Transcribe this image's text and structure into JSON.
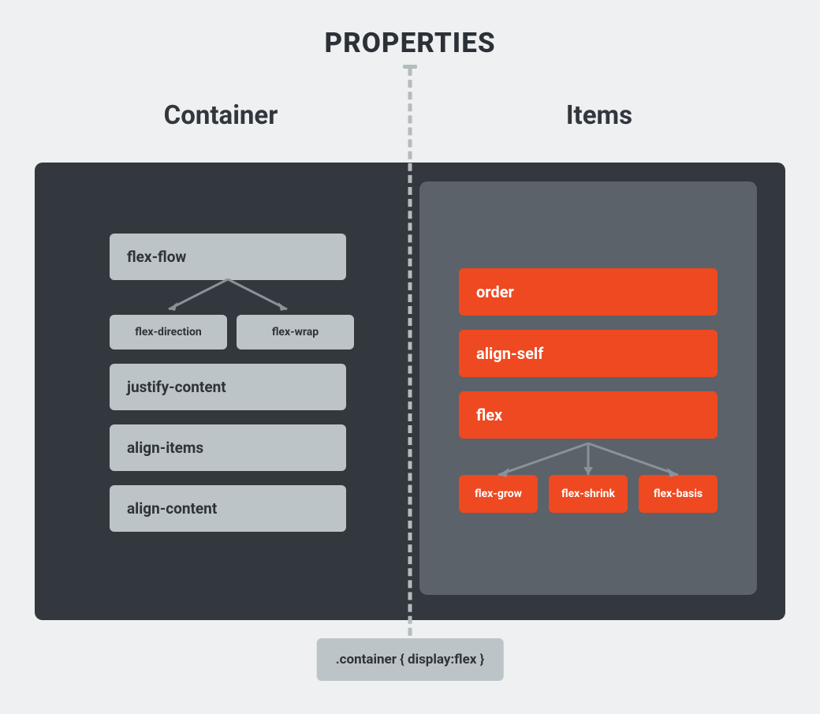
{
  "title": "PROPERTIES",
  "columns": {
    "left_title": "Container",
    "right_title": "Items"
  },
  "container_props": {
    "flex_flow": "flex-flow",
    "flex_direction": "flex-direction",
    "flex_wrap": "flex-wrap",
    "justify_content": "justify-content",
    "align_items": "align-items",
    "align_content": "align-content"
  },
  "item_props": {
    "order": "order",
    "align_self": "align-self",
    "flex": "flex",
    "flex_grow": "flex-grow",
    "flex_shrink": "flex-shrink",
    "flex_basis": "flex-basis"
  },
  "footer_code": ".container { display:flex }"
}
